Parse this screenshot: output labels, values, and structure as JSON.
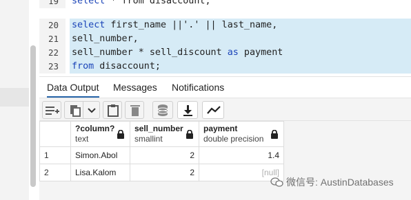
{
  "editor": {
    "lines": [
      {
        "num": "19",
        "parts": [
          {
            "t": "select",
            "k": true
          },
          {
            "t": " * from disaccount;",
            "k": false
          }
        ]
      },
      {
        "num": "20",
        "parts": [
          {
            "t": "select",
            "k": true
          },
          {
            "t": " first_name ||'.' || last_name,",
            "k": false
          }
        ]
      },
      {
        "num": "21",
        "parts": [
          {
            "t": "sell_number,",
            "k": false
          }
        ]
      },
      {
        "num": "22",
        "parts": [
          {
            "t": "sell_number * sell_discount ",
            "k": false
          },
          {
            "t": "as",
            "k": true
          },
          {
            "t": " payment",
            "k": false
          }
        ]
      },
      {
        "num": "23",
        "parts": [
          {
            "t": "from",
            "k": true
          },
          {
            "t": " disaccount;",
            "k": false
          }
        ]
      }
    ]
  },
  "tabs": {
    "data_output": "Data Output",
    "messages": "Messages",
    "notifications": "Notifications"
  },
  "toolbar": {
    "icons": [
      "add-row-icon",
      "copy-icon",
      "chevron-down-icon",
      "paste-icon",
      "delete-icon",
      "database-icon",
      "download-icon",
      "graph-icon"
    ]
  },
  "grid": {
    "columns": [
      {
        "name": "?column?",
        "type": "text"
      },
      {
        "name": "sell_number",
        "type": "smallint"
      },
      {
        "name": "payment",
        "type": "double precision"
      }
    ],
    "rows": [
      {
        "num": "1",
        "col1": "Simon.Abol",
        "col2": "2",
        "col3": "1.4"
      },
      {
        "num": "2",
        "col1": "Lisa.Kalom",
        "col2": "2",
        "col3": "[null]"
      }
    ]
  },
  "watermark": {
    "text": "微信号: AustinDatabases"
  },
  "colors": {
    "keyword": "#1b44b8",
    "highlight": "#d6ebf6",
    "active_tab": "#2563a8"
  }
}
